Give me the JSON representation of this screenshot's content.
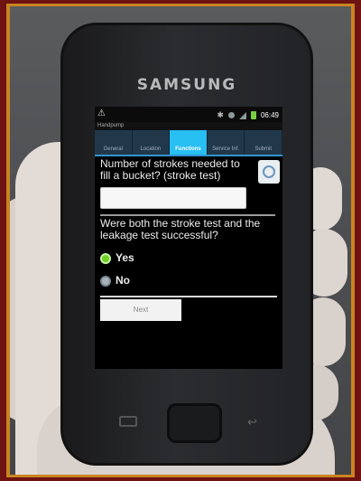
{
  "phone": {
    "brand": "SAMSUNG"
  },
  "status_bar": {
    "time": "06:49",
    "notification_glyph": "⚠"
  },
  "app_bar": {
    "title": "Handpump"
  },
  "tabs": [
    {
      "label": "General",
      "active": false
    },
    {
      "label": "Location",
      "active": false
    },
    {
      "label": "Functions",
      "active": true
    },
    {
      "label": "Service Inf.",
      "active": false
    },
    {
      "label": "Submit",
      "active": false
    }
  ],
  "form": {
    "question1": "Number of strokes needed to fill a bucket? (stroke test)",
    "answer1_value": "",
    "question2": "Were both the stroke test and the leakage test successful?",
    "options": [
      {
        "label": "Yes",
        "selected": true
      },
      {
        "label": "No",
        "selected": false
      }
    ],
    "next_label": "Next"
  },
  "colors": {
    "tab_active": "#28bff2",
    "radio_on": "#6fcf25",
    "frame": "#c9841f",
    "border": "#6e1212"
  },
  "icons": [
    "warning-icon",
    "bluetooth-icon",
    "wifi-icon",
    "signal-icon",
    "battery-icon",
    "info-icon",
    "menu-key-icon",
    "back-key-icon"
  ]
}
